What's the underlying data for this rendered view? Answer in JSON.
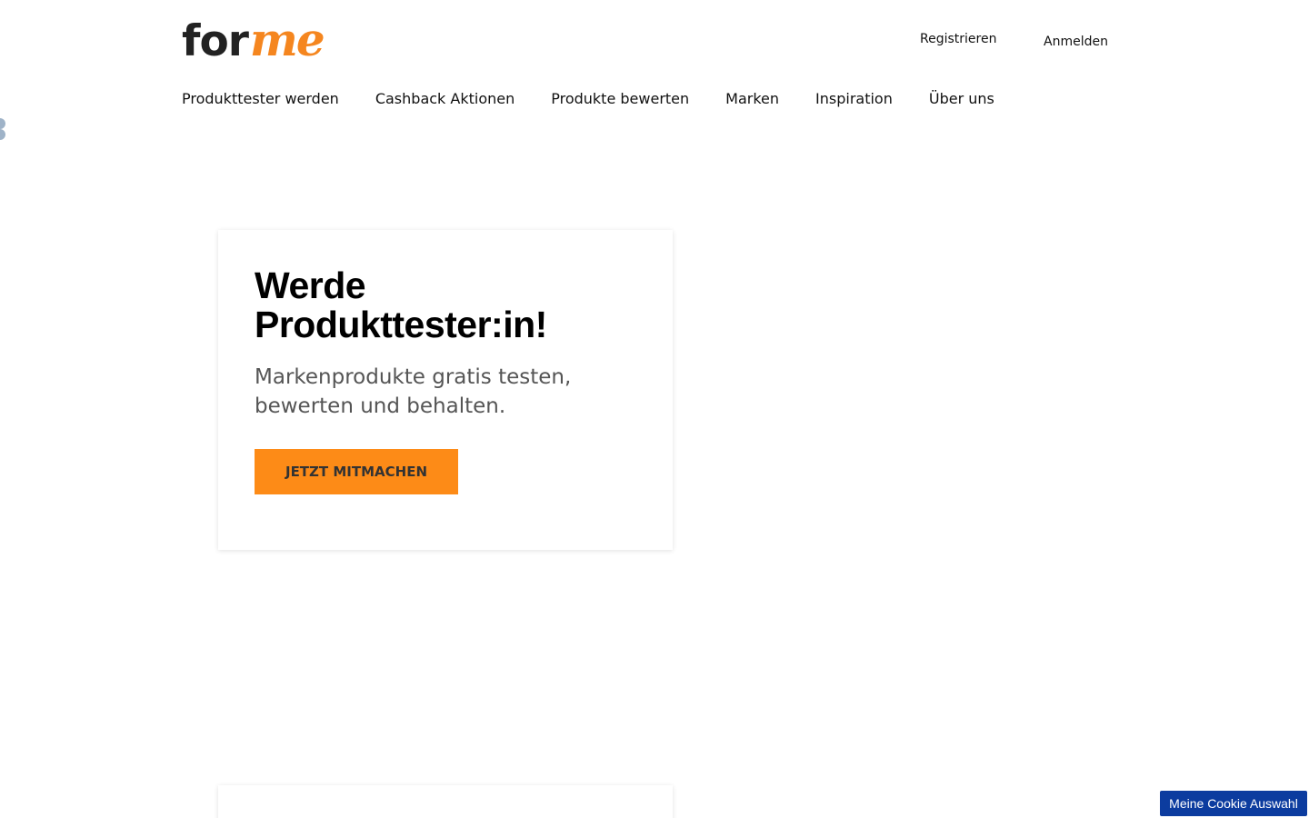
{
  "brand": {
    "logo_part1": "for",
    "logo_part2": "me",
    "accent_color": "#f5861f"
  },
  "header": {
    "register_label": "Registrieren",
    "login_label": "Anmelden"
  },
  "nav": {
    "items": [
      {
        "label": "Produkttester werden"
      },
      {
        "label": "Cashback Aktionen"
      },
      {
        "label": "Produkte bewerten"
      },
      {
        "label": "Marken"
      },
      {
        "label": "Inspiration"
      },
      {
        "label": "Über uns"
      }
    ]
  },
  "hero": {
    "title": "Werde Produkttester:in!",
    "subtitle": "Markenprodukte gratis testen, bewerten und behalten.",
    "cta_label": "JETZT MITMACHEN",
    "cta_color": "#fd8b17"
  },
  "cookie": {
    "button_label": "Meine Cookie Auswahl",
    "button_color": "#0c3c9f"
  }
}
